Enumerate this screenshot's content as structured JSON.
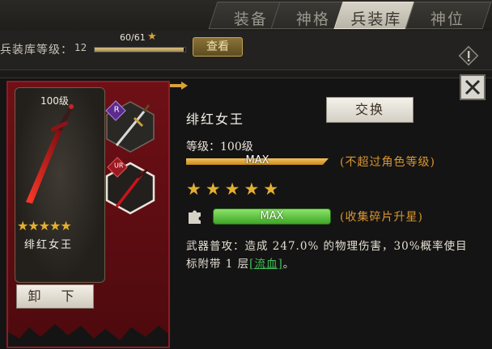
{
  "tabs": [
    {
      "label": "装备",
      "active": false
    },
    {
      "label": "神格",
      "active": false
    },
    {
      "label": "兵装库",
      "active": true
    },
    {
      "label": "神位",
      "active": false
    }
  ],
  "armory": {
    "level_label": "兵装库等级：",
    "level_value": "12",
    "progress_text": "60/61",
    "progress_fraction": 0.98,
    "view_button": "查看"
  },
  "card": {
    "level": "100级",
    "stars": "★★★★★",
    "name": "绯红女王",
    "unequip_button": "卸  下",
    "slot_badges": [
      "R",
      "UR"
    ]
  },
  "detail": {
    "name": "绯红女王",
    "swap_button": "交换",
    "level_line": "等级：100级",
    "level_max": "MAX",
    "level_note": "(不超过角色等级)",
    "stars": "★★★★★",
    "fragment_max": "MAX",
    "fragment_note": "(收集碎片升星)",
    "desc_prefix": "武器普攻：造成 247.0% 的物理伤害，30%概率使目标附带 1 层",
    "desc_link": "[流血]",
    "desc_suffix": "。"
  },
  "colors": {
    "banner_red": "#6e1016",
    "gold": "#e4b030",
    "note_orange": "#d9962f",
    "fragment_green": "#3fa626"
  }
}
